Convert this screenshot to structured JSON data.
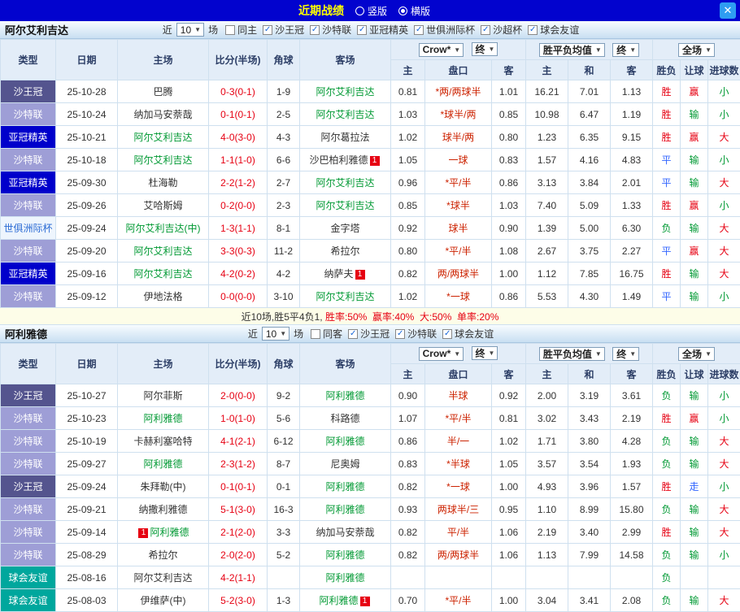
{
  "topbar": {
    "title": "近期战绩",
    "radios": [
      {
        "label": "竖版",
        "selected": false
      },
      {
        "label": "横版",
        "selected": true
      }
    ],
    "close_label": "✕"
  },
  "colors": {
    "score": "#e60012",
    "handicap": "#cc2200",
    "focus_team": "#009933",
    "base_text": "#333333"
  },
  "type_colors": {
    "沙王冠": {
      "bg": "#54548e",
      "fg": "#ffffff"
    },
    "沙特联": {
      "bg": "#9e9ed6",
      "fg": "#ffffff"
    },
    "亚冠精英": {
      "bg": "#0000cb",
      "fg": "#ffffff"
    },
    "世俱洲际杯": {
      "bg": "#eef5fd",
      "fg": "#2b6bd4"
    },
    "球会友谊": {
      "bg": "#00a79d",
      "fg": "#ffffff"
    }
  },
  "result_colors": {
    "胜": "#e60012",
    "平": "#3366ff",
    "负": "#009933",
    "赢": "#e60012",
    "输": "#009933",
    "走": "#3366ff",
    "大": "#e60012",
    "小": "#009933"
  },
  "sections": [
    {
      "team": "阿尔艾利吉达",
      "filters": {
        "near": "近",
        "count": "10",
        "unit": "场",
        "checkboxes": [
          {
            "label": "同主",
            "checked": false
          },
          {
            "label": "沙王冠",
            "checked": true
          },
          {
            "label": "沙特联",
            "checked": true
          },
          {
            "label": "亚冠精英",
            "checked": true
          },
          {
            "label": "世俱洲际杯",
            "checked": true
          },
          {
            "label": "沙超杯",
            "checked": true
          },
          {
            "label": "球会友谊",
            "checked": true
          }
        ]
      },
      "header": {
        "cols": [
          "类型",
          "日期",
          "主场",
          "比分(半场)",
          "角球",
          "客场"
        ],
        "bookmaker": "Crow*",
        "asia_state": "终",
        "europe": "胜平负均值",
        "europe_state": "终",
        "scope": "全场",
        "sub": [
          "主",
          "盘口",
          "客",
          "主",
          "和",
          "客",
          "胜负",
          "让球",
          "进球数"
        ]
      },
      "rows": [
        {
          "type": "沙王冠",
          "date": "25-10-28",
          "home": "巴腾",
          "score": "0-3(0-1)",
          "corner": "1-9",
          "away": "阿尔艾利吉达",
          "away_focus": true,
          "h": "0.81",
          "hc": "*两/两球半",
          "a": "1.01",
          "eh": "16.21",
          "ed": "7.01",
          "ea": "1.13",
          "wdl": "胜",
          "let": "赢",
          "goal": "小"
        },
        {
          "type": "沙特联",
          "date": "25-10-24",
          "home": "纳加马安萘哉",
          "score": "0-1(0-1)",
          "corner": "2-5",
          "away": "阿尔艾利吉达",
          "away_focus": true,
          "h": "1.03",
          "hc": "*球半/两",
          "a": "0.85",
          "eh": "10.98",
          "ed": "6.47",
          "ea": "1.19",
          "wdl": "胜",
          "let": "输",
          "goal": "小"
        },
        {
          "type": "亚冠精英",
          "date": "25-10-21",
          "home": "阿尔艾利吉达",
          "home_focus": true,
          "score": "4-0(3-0)",
          "corner": "4-3",
          "away": "阿尔葛拉法",
          "h": "1.02",
          "hc": "球半/两",
          "a": "0.80",
          "eh": "1.23",
          "ed": "6.35",
          "ea": "9.15",
          "wdl": "胜",
          "let": "赢",
          "goal": "大"
        },
        {
          "type": "沙特联",
          "date": "25-10-18",
          "home": "阿尔艾利吉达",
          "home_focus": true,
          "score": "1-1(1-0)",
          "corner": "6-6",
          "away": "沙巴柏利雅德",
          "away_badge_after": "1",
          "h": "1.05",
          "hc": "一球",
          "a": "0.83",
          "eh": "1.57",
          "ed": "4.16",
          "ea": "4.83",
          "wdl": "平",
          "let": "输",
          "goal": "小"
        },
        {
          "type": "亚冠精英",
          "date": "25-09-30",
          "home": "杜海勒",
          "score": "2-2(1-2)",
          "corner": "2-7",
          "away": "阿尔艾利吉达",
          "away_focus": true,
          "h": "0.96",
          "hc": "*平/半",
          "a": "0.86",
          "eh": "3.13",
          "ed": "3.84",
          "ea": "2.01",
          "wdl": "平",
          "let": "输",
          "goal": "大"
        },
        {
          "type": "沙特联",
          "date": "25-09-26",
          "home": "艾哈斯姆",
          "score": "0-2(0-0)",
          "corner": "2-3",
          "away": "阿尔艾利吉达",
          "away_focus": true,
          "h": "0.85",
          "hc": "*球半",
          "a": "1.03",
          "eh": "7.40",
          "ed": "5.09",
          "ea": "1.33",
          "wdl": "胜",
          "let": "赢",
          "goal": "小"
        },
        {
          "type": "世俱洲际杯",
          "date": "25-09-24",
          "home": "阿尔艾利吉达(中)",
          "home_focus": true,
          "score": "1-3(1-1)",
          "corner": "8-1",
          "away": "金字塔",
          "h": "0.92",
          "hc": "球半",
          "a": "0.90",
          "eh": "1.39",
          "ed": "5.00",
          "ea": "6.30",
          "wdl": "负",
          "let": "输",
          "goal": "大"
        },
        {
          "type": "沙特联",
          "date": "25-09-20",
          "home": "阿尔艾利吉达",
          "home_focus": true,
          "score": "3-3(0-3)",
          "corner": "11-2",
          "away": "希拉尔",
          "h": "0.80",
          "hc": "*平/半",
          "a": "1.08",
          "eh": "2.67",
          "ed": "3.75",
          "ea": "2.27",
          "wdl": "平",
          "let": "赢",
          "goal": "大"
        },
        {
          "type": "亚冠精英",
          "date": "25-09-16",
          "home": "阿尔艾利吉达",
          "home_focus": true,
          "score": "4-2(0-2)",
          "corner": "4-2",
          "away": "纳萨夫",
          "away_badge_after": "1",
          "h": "0.82",
          "hc": "两/两球半",
          "a": "1.00",
          "eh": "1.12",
          "ed": "7.85",
          "ea": "16.75",
          "wdl": "胜",
          "let": "输",
          "goal": "大"
        },
        {
          "type": "沙特联",
          "date": "25-09-12",
          "home": "伊地法格",
          "score": "0-0(0-0)",
          "corner": "3-10",
          "away": "阿尔艾利吉达",
          "away_focus": true,
          "h": "1.02",
          "hc": "*一球",
          "a": "0.86",
          "eh": "5.53",
          "ed": "4.30",
          "ea": "1.49",
          "wdl": "平",
          "let": "输",
          "goal": "小"
        }
      ],
      "footer": [
        {
          "text": "近10场,胜5平4负1, ",
          "color": "#333333"
        },
        {
          "text": "胜率:50%",
          "color": "#e60012"
        },
        {
          "text": "  赢率:40%",
          "color": "#e60012"
        },
        {
          "text": "  大:50%",
          "color": "#e60012"
        },
        {
          "text": "  单率:20%",
          "color": "#e60012"
        }
      ]
    },
    {
      "team": "阿利雅德",
      "filters": {
        "near": "近",
        "count": "10",
        "unit": "场",
        "checkboxes": [
          {
            "label": "同客",
            "checked": false
          },
          {
            "label": "沙王冠",
            "checked": true
          },
          {
            "label": "沙特联",
            "checked": true
          },
          {
            "label": "球会友谊",
            "checked": true
          }
        ]
      },
      "header": {
        "cols": [
          "类型",
          "日期",
          "主场",
          "比分(半场)",
          "角球",
          "客场"
        ],
        "bookmaker": "Crow*",
        "asia_state": "终",
        "europe": "胜平负均值",
        "europe_state": "终",
        "scope": "全场",
        "sub": [
          "主",
          "盘口",
          "客",
          "主",
          "和",
          "客",
          "胜负",
          "让球",
          "进球数"
        ]
      },
      "rows": [
        {
          "type": "沙王冠",
          "date": "25-10-27",
          "home": "阿尔菲斯",
          "score": "2-0(0-0)",
          "corner": "9-2",
          "away": "阿利雅德",
          "away_focus": true,
          "h": "0.90",
          "hc": "半球",
          "a": "0.92",
          "eh": "2.00",
          "ed": "3.19",
          "ea": "3.61",
          "wdl": "负",
          "let": "输",
          "goal": "小"
        },
        {
          "type": "沙特联",
          "date": "25-10-23",
          "home": "阿利雅德",
          "home_focus": true,
          "score": "1-0(1-0)",
          "corner": "5-6",
          "away": "科路德",
          "h": "1.07",
          "hc": "*平/半",
          "a": "0.81",
          "eh": "3.02",
          "ed": "3.43",
          "ea": "2.19",
          "wdl": "胜",
          "let": "赢",
          "goal": "小"
        },
        {
          "type": "沙特联",
          "date": "25-10-19",
          "home": "卡赫利塞哈特",
          "score": "4-1(2-1)",
          "corner": "6-12",
          "away": "阿利雅德",
          "away_focus": true,
          "h": "0.86",
          "hc": "半/一",
          "a": "1.02",
          "eh": "1.71",
          "ed": "3.80",
          "ea": "4.28",
          "wdl": "负",
          "let": "输",
          "goal": "大"
        },
        {
          "type": "沙特联",
          "date": "25-09-27",
          "home": "阿利雅德",
          "home_focus": true,
          "score": "2-3(1-2)",
          "corner": "8-7",
          "away": "尼奥姆",
          "h": "0.83",
          "hc": "*半球",
          "a": "1.05",
          "eh": "3.57",
          "ed": "3.54",
          "ea": "1.93",
          "wdl": "负",
          "let": "输",
          "goal": "大"
        },
        {
          "type": "沙王冠",
          "date": "25-09-24",
          "home": "朱拜勒(中)",
          "score": "0-1(0-1)",
          "corner": "0-1",
          "away": "阿利雅德",
          "away_focus": true,
          "h": "0.82",
          "hc": "*一球",
          "a": "1.00",
          "eh": "4.93",
          "ed": "3.96",
          "ea": "1.57",
          "wdl": "胜",
          "let": "走",
          "goal": "小"
        },
        {
          "type": "沙特联",
          "date": "25-09-21",
          "home": "纳撒利雅德",
          "score": "5-1(3-0)",
          "corner": "16-3",
          "away": "阿利雅德",
          "away_focus": true,
          "h": "0.93",
          "hc": "两球半/三",
          "a": "0.95",
          "eh": "1.10",
          "ed": "8.99",
          "ea": "15.80",
          "wdl": "负",
          "let": "输",
          "goal": "大"
        },
        {
          "type": "沙特联",
          "date": "25-09-14",
          "home": "阿利雅德",
          "home_focus": true,
          "home_badge_before": "1",
          "score": "2-1(2-0)",
          "corner": "3-3",
          "away": "纳加马安萘哉",
          "h": "0.82",
          "hc": "平/半",
          "a": "1.06",
          "eh": "2.19",
          "ed": "3.40",
          "ea": "2.99",
          "wdl": "胜",
          "let": "输",
          "goal": "大"
        },
        {
          "type": "沙特联",
          "date": "25-08-29",
          "home": "希拉尔",
          "score": "2-0(2-0)",
          "corner": "5-2",
          "away": "阿利雅德",
          "away_focus": true,
          "h": "0.82",
          "hc": "两/两球半",
          "a": "1.06",
          "eh": "1.13",
          "ed": "7.99",
          "ea": "14.58",
          "wdl": "负",
          "let": "输",
          "goal": "小"
        },
        {
          "type": "球会友谊",
          "date": "25-08-16",
          "home": "阿尔艾利吉达",
          "score": "4-2(1-1)",
          "corner": "",
          "away": "阿利雅德",
          "away_focus": true,
          "h": "",
          "hc": "",
          "a": "",
          "eh": "",
          "ed": "",
          "ea": "",
          "wdl": "负",
          "let": "",
          "goal": ""
        },
        {
          "type": "球会友谊",
          "date": "25-08-03",
          "home": "伊维萨(中)",
          "score": "5-2(3-0)",
          "corner": "1-3",
          "away": "阿利雅德",
          "away_focus": true,
          "away_badge_after": "1",
          "h": "0.70",
          "hc": "*平/半",
          "a": "1.00",
          "eh": "3.04",
          "ed": "3.41",
          "ea": "2.08",
          "wdl": "负",
          "let": "输",
          "goal": "大"
        }
      ],
      "footer": []
    }
  ]
}
